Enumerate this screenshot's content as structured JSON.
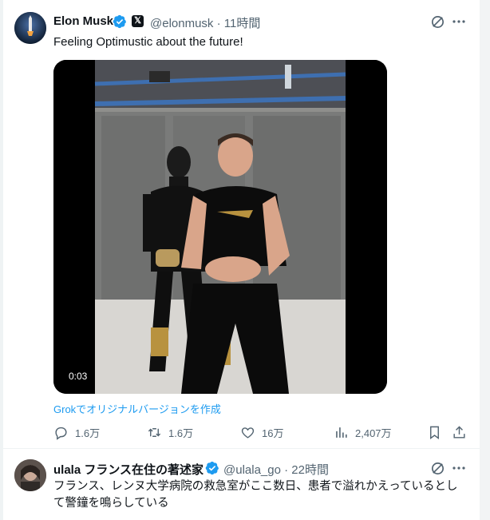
{
  "post": {
    "author_name": "Elon Musk",
    "x_badge": "𝕏",
    "handle_time": "@elonmusk · 11時間",
    "text": "Feeling Optimustic about the future!",
    "video_time": "0:03",
    "grok_link": "Grokでオリジナルバージョンを作成",
    "stats": {
      "replies": "1.6万",
      "reposts": "1.6万",
      "likes": "16万",
      "views": "2,407万"
    }
  },
  "next_post": {
    "author_name": "ulala フランス在住の著述家",
    "handle_time": "@ulala_go · 22時間",
    "text_line1": "フランス、レンヌ大学病院の救急室がここ数日、患者で溢れかえっているとし",
    "text_line2": "て警鐘を鳴らしている"
  },
  "colors": {
    "accent": "#1d9bf0",
    "secondary_text": "#536471",
    "verified": "#1d9bf0"
  },
  "icons": [
    "verified-badge-icon",
    "x-premium-icon",
    "grok-icon",
    "more-icon",
    "reply-icon",
    "repost-icon",
    "like-icon",
    "views-icon",
    "bookmark-icon",
    "share-icon"
  ]
}
